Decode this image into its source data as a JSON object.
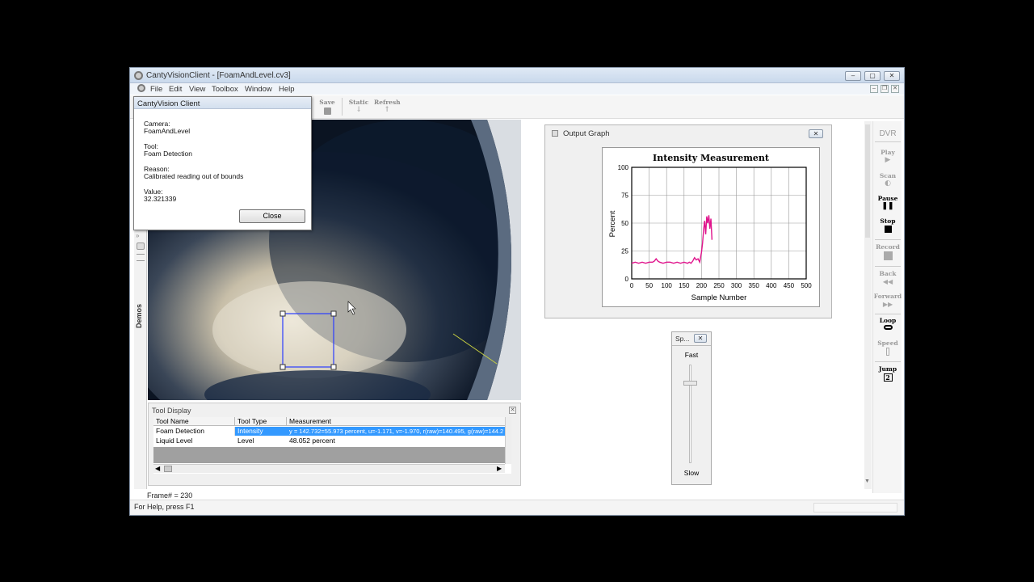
{
  "window": {
    "title": "CantyVisionClient - [FoamAndLevel.cv3]"
  },
  "menu": [
    "File",
    "Edit",
    "View",
    "Toolbox",
    "Window",
    "Help"
  ],
  "toolbar": {
    "save": "Save",
    "static": "Static",
    "refresh": "Refresh"
  },
  "dialog": {
    "title": "CantyVision Client",
    "camera_label": "Camera:",
    "camera_value": "FoamAndLevel",
    "tool_label": "Tool:",
    "tool_value": "Foam Detection",
    "reason_label": "Reason:",
    "reason_value": "Calibrated reading out of bounds",
    "value_label": "Value:",
    "value_value": "32.321339",
    "close_label": "Close"
  },
  "sidebar": {
    "demos": "Demos"
  },
  "tool_display": {
    "title": "Tool Display",
    "columns": [
      "Tool Name",
      "Tool Type",
      "Measurement"
    ],
    "rows": [
      {
        "name": "Foam Detection",
        "type": "Intensity",
        "measurement": "y = 142.732=55.973 percent, u=-1.171, v=-1.970, r(raw)=140.495, g(raw)=144.2"
      },
      {
        "name": "Liquid Level",
        "type": "Level",
        "measurement": "48.052 percent"
      }
    ]
  },
  "frame_text": "Frame# = 230",
  "status_text": "For Help, press F1",
  "output_graph": {
    "title": "Output Graph"
  },
  "chart_data": {
    "type": "line",
    "title": "Intensity Measurement",
    "xlabel": "Sample Number",
    "ylabel": "Percent",
    "xlim": [
      0,
      500
    ],
    "ylim": [
      0,
      100
    ],
    "xticks": [
      0,
      50,
      100,
      150,
      200,
      250,
      300,
      350,
      400,
      450,
      500
    ],
    "yticks": [
      0,
      25,
      50,
      75,
      100
    ],
    "grid": true,
    "series": [
      {
        "color": "#e0148c",
        "x": [
          0,
          10,
          20,
          30,
          40,
          50,
          60,
          65,
          70,
          75,
          80,
          90,
          100,
          110,
          120,
          130,
          140,
          150,
          160,
          165,
          170,
          175,
          180,
          185,
          190,
          195,
          200,
          203,
          206,
          209,
          212,
          215,
          218,
          221,
          224,
          227,
          230
        ],
        "y": [
          14,
          15,
          14,
          15,
          14,
          15,
          15,
          16,
          18,
          16,
          15,
          14,
          15,
          15,
          14,
          15,
          14,
          15,
          14,
          15,
          14,
          16,
          19,
          17,
          18,
          15,
          24,
          32,
          44,
          52,
          40,
          56,
          50,
          57,
          45,
          54,
          35
        ]
      }
    ]
  },
  "speed": {
    "title": "Sp...",
    "fast": "Fast",
    "slow": "Slow"
  },
  "dvr": {
    "title": "DVR",
    "play": "Play",
    "scan": "Scan",
    "pause": "Pause",
    "stop": "Stop",
    "record": "Record",
    "back": "Back",
    "forward": "Forward",
    "loop": "Loop",
    "speed": "Speed",
    "jump": "Jump",
    "jump_value": "2"
  }
}
